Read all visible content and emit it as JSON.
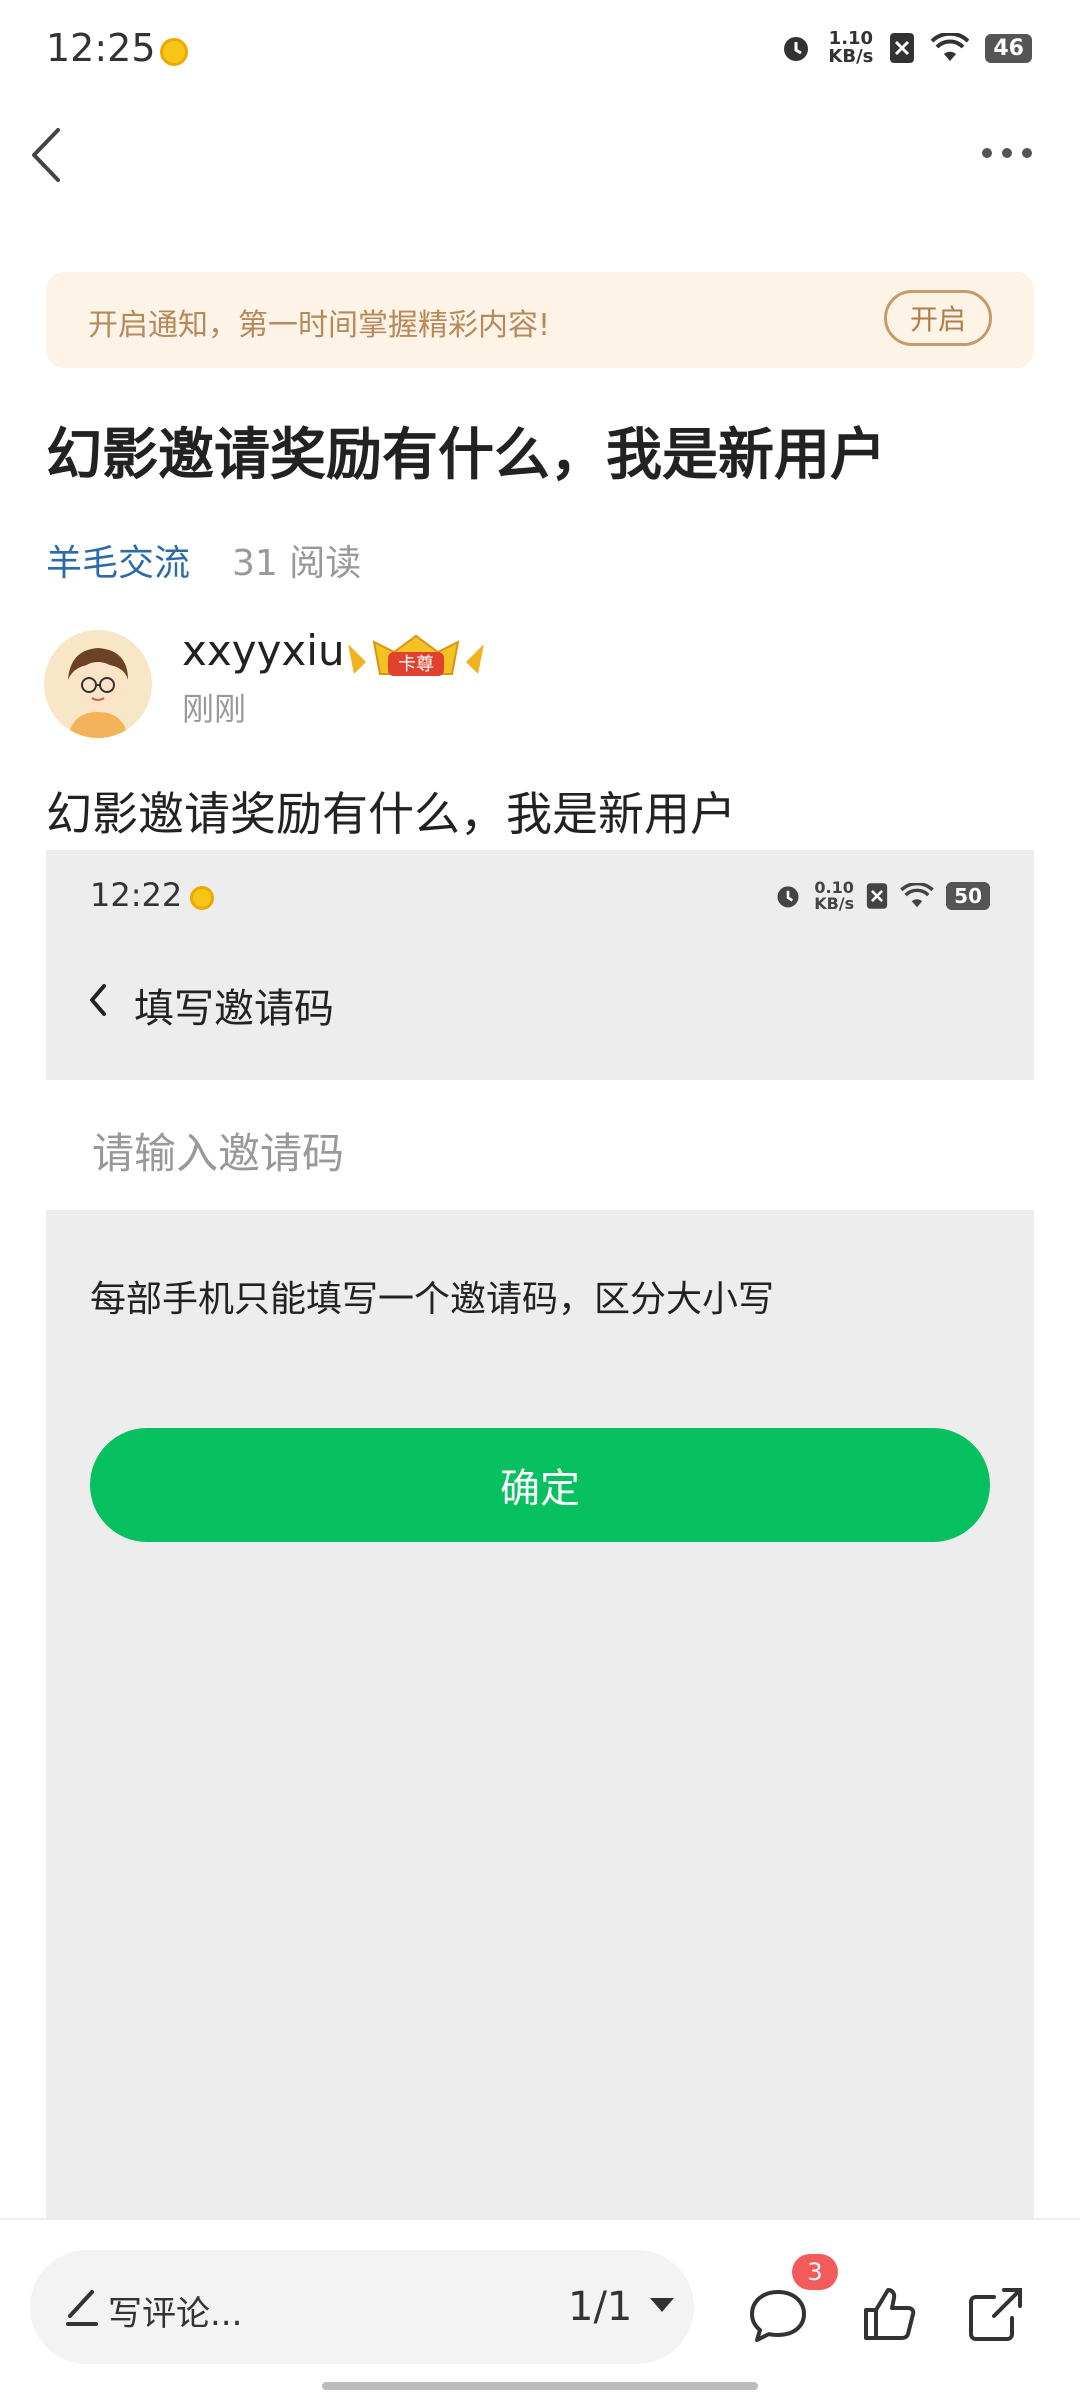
{
  "status_bar": {
    "time": "12:25",
    "speed_value": "1.10",
    "speed_unit": "KB/s",
    "battery": "46"
  },
  "notification": {
    "text": "开启通知，第一时间掌握精彩内容!",
    "button": "开启"
  },
  "post": {
    "title": "幻影邀请奖励有什么，我是新用户",
    "category": "羊毛交流",
    "reads": "31 阅读",
    "author": {
      "name": "xxyyxiu",
      "badge": "卡尊",
      "time": "刚刚"
    },
    "body": "幻影邀请奖励有什么，我是新用户"
  },
  "embedded_screenshot": {
    "status": {
      "time": "12:22",
      "speed_value": "0.10",
      "speed_unit": "KB/s",
      "battery": "50"
    },
    "page_title": "填写邀请码",
    "input_placeholder": "请输入邀请码",
    "hint": "每部手机只能填写一个邀请码，区分大小写",
    "confirm_button": "确定",
    "button_color": "#07c160"
  },
  "bottom_bar": {
    "comment_placeholder": "写评论...",
    "page_indicator": "1/1",
    "comment_badge": "3",
    "icons": [
      "comment-icon",
      "like-icon",
      "share-icon"
    ]
  }
}
